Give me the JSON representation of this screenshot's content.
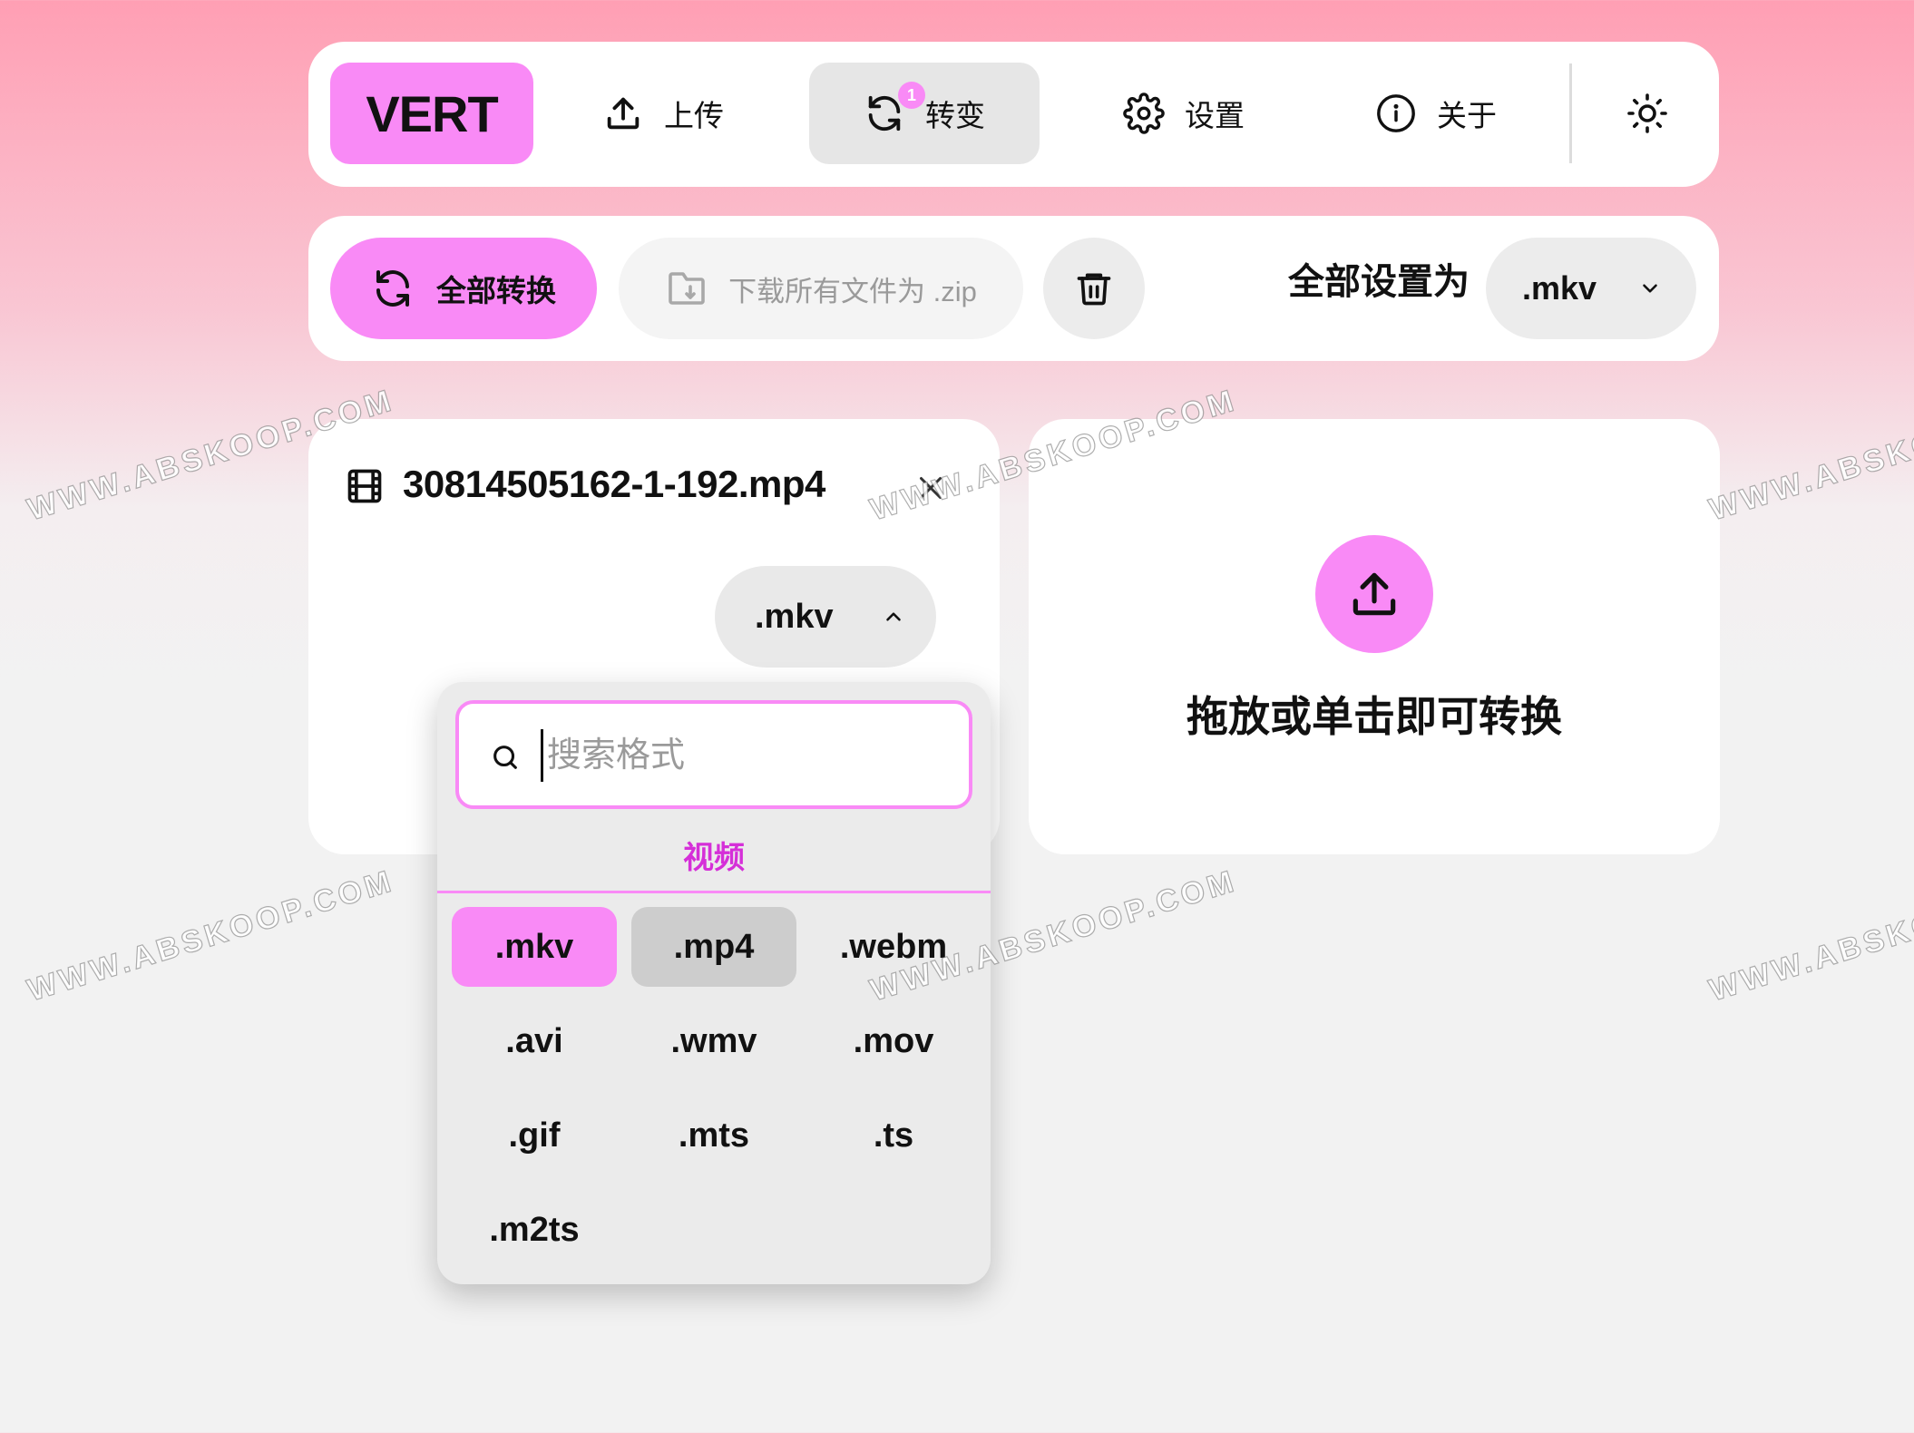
{
  "nav": {
    "logo": "VERT",
    "items": [
      {
        "label": "上传",
        "icon": "upload-icon"
      },
      {
        "label": "转变",
        "icon": "convert-icon",
        "badge": "1",
        "active": true
      },
      {
        "label": "设置",
        "icon": "gear-icon"
      },
      {
        "label": "关于",
        "icon": "info-icon"
      }
    ],
    "theme_icon": "sun-icon"
  },
  "toolbar": {
    "convert_all": "全部转换",
    "download_zip": "下载所有文件为 .zip",
    "delete_icon": "trash-icon",
    "set_all_label": "全部设置为",
    "set_all_value": ".mkv"
  },
  "file": {
    "name": "30814505162-1-192.mp4",
    "format": ".mkv"
  },
  "dropdown": {
    "search_placeholder": "搜索格式",
    "category": "视频",
    "formats": [
      ".mkv",
      ".mp4",
      ".webm",
      ".avi",
      ".wmv",
      ".mov",
      ".gif",
      ".mts",
      ".ts",
      ".m2ts"
    ],
    "selected": ".mkv",
    "hovered": ".mp4"
  },
  "dropzone": {
    "label": "拖放或单击即可转换"
  },
  "watermark": "WWW.ABSKOOP.COM",
  "colors": {
    "accent": "#f98af6",
    "accent_text": "#d52fd8",
    "surface": "#ffffff",
    "muted": "#ececec"
  }
}
